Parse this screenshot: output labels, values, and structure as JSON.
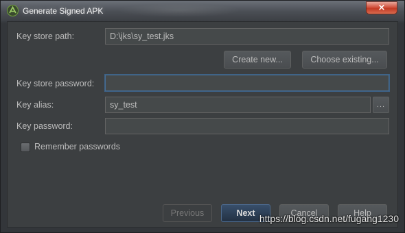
{
  "window": {
    "title": "Generate Signed APK",
    "close_label": "×"
  },
  "form": {
    "keystore_path": {
      "label": "Key store path:",
      "value": "D:\\jks\\sy_test.jks"
    },
    "create_new_label": "Create new...",
    "choose_existing_label": "Choose existing...",
    "keystore_password": {
      "label": "Key store password:",
      "value": ""
    },
    "key_alias": {
      "label": "Key alias:",
      "value": "sy_test",
      "browse_label": "..."
    },
    "key_password": {
      "label": "Key password:",
      "value": ""
    },
    "remember_label": "Remember passwords",
    "remember_checked": false
  },
  "footer": {
    "previous_label": "Previous",
    "next_label": "Next",
    "cancel_label": "Cancel",
    "help_label": "Help"
  },
  "watermark": "https://blog.csdn.net/fugang1230",
  "colors": {
    "panel": "#3c3f41",
    "field": "#45494a",
    "accent": "#466d94",
    "close": "#c23a24",
    "android_green": "#8bc34a"
  }
}
